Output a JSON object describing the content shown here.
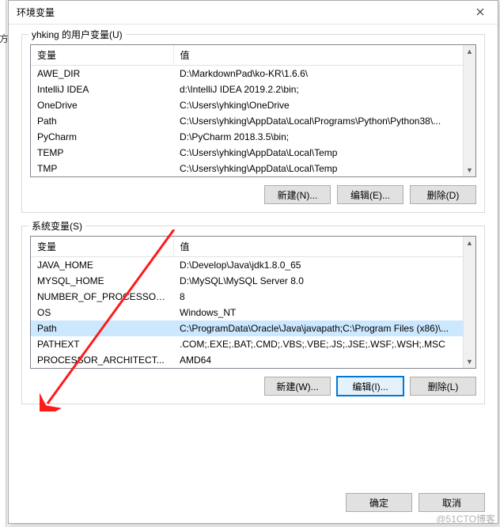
{
  "dialog": {
    "title": "环境变量",
    "close_icon": "close"
  },
  "bg_char": "方",
  "user_vars": {
    "group_label": "yhking 的用户变量(U)",
    "headers": {
      "name": "变量",
      "value": "值"
    },
    "rows": [
      {
        "name": "AWE_DIR",
        "value": "D:\\MarkdownPad\\ko-KR\\1.6.6\\"
      },
      {
        "name": "IntelliJ IDEA",
        "value": "d:\\IntelliJ IDEA 2019.2.2\\bin;"
      },
      {
        "name": "OneDrive",
        "value": "C:\\Users\\yhking\\OneDrive"
      },
      {
        "name": "Path",
        "value": "C:\\Users\\yhking\\AppData\\Local\\Programs\\Python\\Python38\\..."
      },
      {
        "name": "PyCharm",
        "value": "D:\\PyCharm 2018.3.5\\bin;"
      },
      {
        "name": "TEMP",
        "value": "C:\\Users\\yhking\\AppData\\Local\\Temp"
      },
      {
        "name": "TMP",
        "value": "C:\\Users\\yhking\\AppData\\Local\\Temp"
      }
    ],
    "buttons": {
      "new": "新建(N)...",
      "edit": "编辑(E)...",
      "delete": "删除(D)"
    }
  },
  "system_vars": {
    "group_label": "系统变量(S)",
    "headers": {
      "name": "变量",
      "value": "值"
    },
    "rows": [
      {
        "name": "JAVA_HOME",
        "value": "D:\\Develop\\Java\\jdk1.8.0_65"
      },
      {
        "name": "MYSQL_HOME",
        "value": "D:\\MySQL\\MySQL Server 8.0"
      },
      {
        "name": "NUMBER_OF_PROCESSORS",
        "value": "8"
      },
      {
        "name": "OS",
        "value": "Windows_NT"
      },
      {
        "name": "Path",
        "value": "C:\\ProgramData\\Oracle\\Java\\javapath;C:\\Program Files (x86)\\..."
      },
      {
        "name": "PATHEXT",
        "value": ".COM;.EXE;.BAT;.CMD;.VBS;.VBE;.JS;.JSE;.WSF;.WSH;.MSC"
      },
      {
        "name": "PROCESSOR_ARCHITECT...",
        "value": "AMD64"
      }
    ],
    "selected_index": 4,
    "buttons": {
      "new": "新建(W)...",
      "edit": "编辑(I)...",
      "delete": "删除(L)"
    }
  },
  "footer": {
    "ok": "确定",
    "cancel": "取消"
  },
  "watermark": "@51CTO博客"
}
